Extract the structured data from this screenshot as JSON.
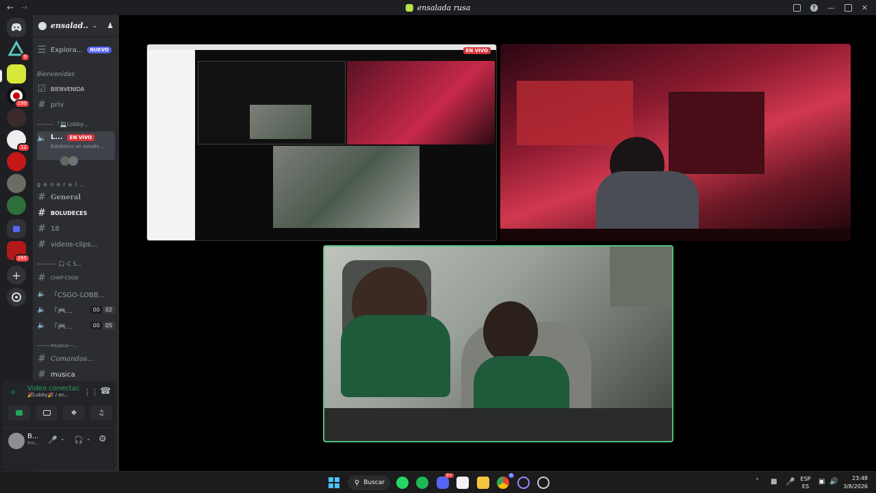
{
  "window": {
    "title": "ensalada rusa",
    "controls": [
      "minimize",
      "maximize",
      "close"
    ]
  },
  "server_rail": {
    "badges": [
      "9",
      "199",
      "12",
      "265"
    ]
  },
  "server_header": {
    "name": "ensalad..."
  },
  "explore": {
    "label": "Explora...",
    "badge": "NUEVO"
  },
  "channels": {
    "welcome_category": "Bienvenidas",
    "welcome_channel": "BIENVENIDA",
    "priv": "priv",
    "lobby_category": "-------- 『💻Lobby...",
    "lobby_voice": "L...",
    "lobby_live": "EN VIVO",
    "lobby_status": "Establece un estado ...",
    "general_category": "g e n e r a l...",
    "general": "General",
    "boludeces": "BOLUDECES",
    "ch18": "18",
    "videos": "videos-clips...",
    "csgo_category": "---------- 🎧-C S...",
    "chat_csgo": "CHAT-CSGO",
    "csgo_lobby": "『CSGO-LOBB...",
    "voice_a": "『🎮...",
    "voice_a_counts": [
      "00",
      "02"
    ],
    "voice_b": "『🎮...",
    "voice_b_counts": [
      "00",
      "05"
    ],
    "musica_category": "--------musica---...",
    "comandos": "Comandos...",
    "musica": "musica"
  },
  "voice_panel": {
    "status": "Video conectac",
    "channel": "🎉Lobby🎉 / en..."
  },
  "user": {
    "name": "B...",
    "status": "Inv..."
  },
  "stage": {
    "live_label": "EN VIVO"
  },
  "taskbar": {
    "search": "Buscar",
    "lang_top": "ESP",
    "lang_bottom": "ES",
    "time": "23:48",
    "date": "3/8/2026",
    "discord_badge": "9+",
    "chrome_badge": "b"
  },
  "colors": {
    "accent": "#5865f2",
    "live": "#da373c",
    "voice_green": "#23a559",
    "stage_border": "#4ec27a"
  }
}
